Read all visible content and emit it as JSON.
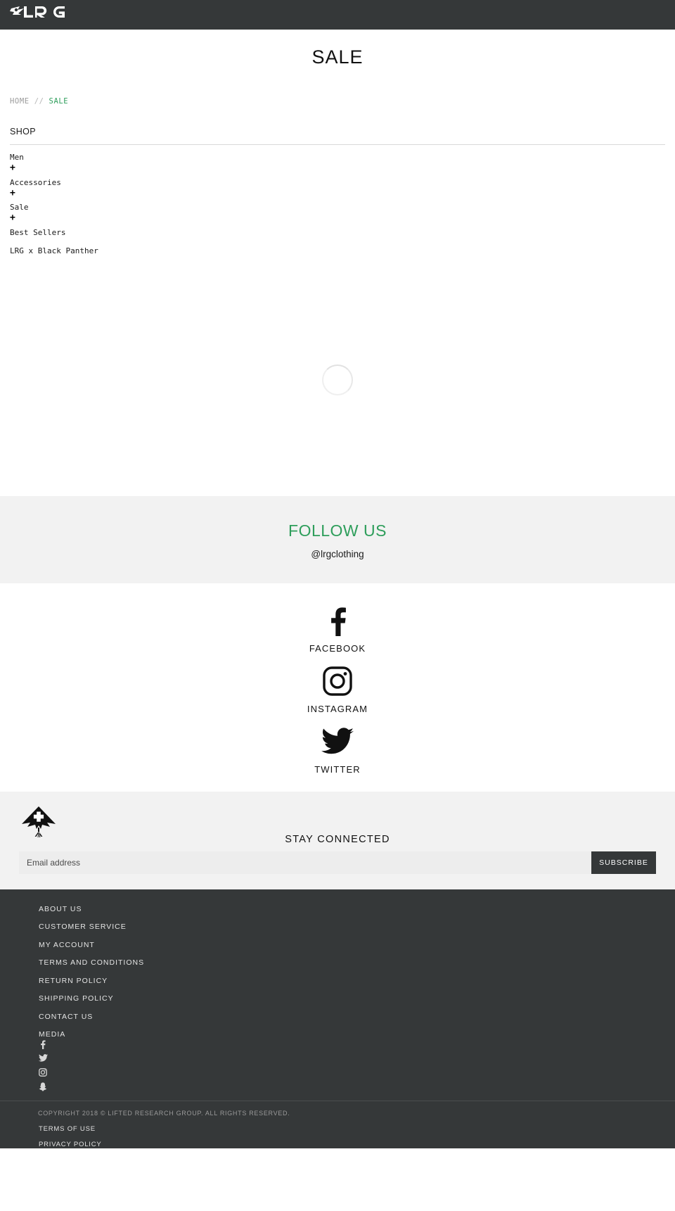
{
  "header": {
    "logo_alt": "LRG",
    "background": "#353839"
  },
  "page": {
    "title": "SALE"
  },
  "breadcrumb": {
    "home": "HOME",
    "separator": "//",
    "current": "SALE",
    "current_color": "#2e9e5b"
  },
  "shop_nav": {
    "heading": "SHOP",
    "items": [
      {
        "label": "Men",
        "expander": "+"
      },
      {
        "label": "Accessories",
        "expander": "+"
      },
      {
        "label": "Sale",
        "expander": "+"
      },
      {
        "label": "Best Sellers",
        "expander": ""
      },
      {
        "label": "LRG x Black Panther",
        "expander": ""
      }
    ]
  },
  "content": {
    "state": "loading",
    "spinner_icon": "loading-spinner-icon"
  },
  "follow": {
    "title": "FOLLOW US",
    "title_color": "#2e9e5b",
    "handle": "@lrgclothing",
    "background": "#f2f2f2"
  },
  "social_links": [
    {
      "icon": "facebook-icon",
      "label": "FACEBOOK"
    },
    {
      "icon": "instagram-icon",
      "label": "INSTAGRAM"
    },
    {
      "icon": "twitter-icon",
      "label": "TWITTER"
    }
  ],
  "newsletter": {
    "logo_icon": "lrg-tree-logo-icon",
    "title": "STAY CONNECTED",
    "email_placeholder": "Email address",
    "email_value": "",
    "submit_label": "SUBSCRIBE",
    "background": "#f2f2f2",
    "button_color": "#353839"
  },
  "footer": {
    "background": "#353839",
    "links": [
      "ABOUT US",
      "CUSTOMER SERVICE",
      "MY ACCOUNT",
      "TERMS AND CONDITIONS",
      "RETURN POLICY",
      "SHIPPING POLICY",
      "CONTACT US",
      "MEDIA"
    ],
    "social_icons": [
      "facebook-icon",
      "twitter-icon",
      "instagram-icon",
      "snapchat-icon"
    ],
    "copyright": "COPYRIGHT 2018 © LIFTED RESEARCH GROUP. ALL RIGHTS RESERVED.",
    "legal_links": [
      "TERMS OF USE",
      "PRIVACY POLICY"
    ]
  }
}
